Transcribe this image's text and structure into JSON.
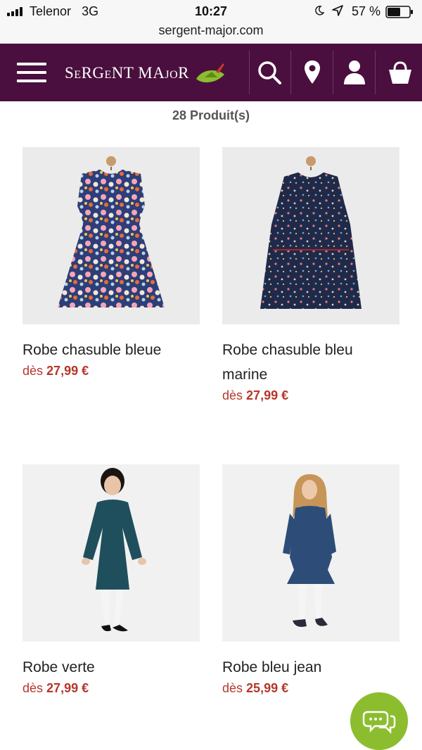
{
  "status_bar": {
    "carrier": "Telenor",
    "network": "3G",
    "time": "10:27",
    "battery": "57 %",
    "icons": [
      "signal-bars-icon",
      "moon-icon",
      "location-arrow-icon",
      "battery-icon"
    ]
  },
  "browser": {
    "url": "sergent-major.com"
  },
  "header": {
    "logo_text": "SeRGeNT MAjoR",
    "icons": [
      "menu-icon",
      "search-icon",
      "location-pin-icon",
      "account-icon",
      "cart-icon"
    ],
    "background": "#4a0f3e"
  },
  "listing": {
    "count_label": "28 Produit(s)"
  },
  "products": [
    {
      "name": "Robe chasuble bleue",
      "price_prefix": "dès",
      "price": "27,99 €"
    },
    {
      "name": "Robe chasuble bleu marine",
      "price_prefix": "dès",
      "price": "27,99 €"
    },
    {
      "name": "Robe verte",
      "price_prefix": "dès",
      "price": "27,99 €"
    },
    {
      "name": "Robe bleu jean",
      "price_prefix": "dès",
      "price": "25,99 €"
    }
  ],
  "chat": {
    "icon": "chat-bubble-icon",
    "color": "#8cbd2f"
  },
  "colors": {
    "price": "#b5372b",
    "accent_green": "#8cbd2f"
  }
}
